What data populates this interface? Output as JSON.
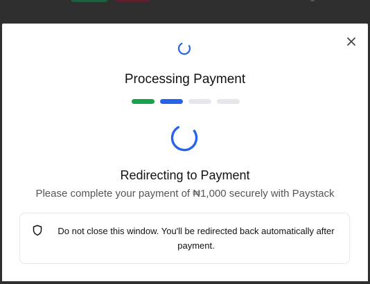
{
  "modal": {
    "title": "Processing Payment",
    "close_icon": "close-icon",
    "steps": [
      {
        "state": "complete",
        "color": "#16a34a"
      },
      {
        "state": "active",
        "color": "#2563eb"
      },
      {
        "state": "pending",
        "color": "#e5e7eb"
      },
      {
        "state": "pending",
        "color": "#e5e7eb"
      }
    ],
    "status_heading": "Redirecting to Payment",
    "status_text": "Please complete your payment of ₦1,000 securely with Paystack",
    "notice": {
      "icon": "shield-icon",
      "text": "Do not close this window. You'll be redirected back automatically after payment."
    }
  },
  "colors": {
    "spinner": "#2563eb",
    "backdrop": "#2f2f2f"
  }
}
